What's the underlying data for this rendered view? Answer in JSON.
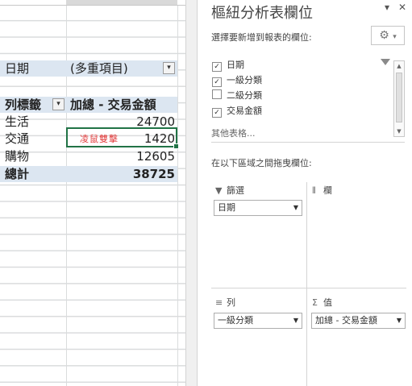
{
  "pivot": {
    "filter_label": "日期",
    "filter_value": "(多重項目)",
    "row_header": "列標籤",
    "value_header": "加總 - 交易金額",
    "rows": [
      {
        "label": "生活",
        "value": "24700"
      },
      {
        "label": "交通",
        "value": "1420"
      },
      {
        "label": "購物",
        "value": "12605"
      }
    ],
    "total_label": "總計",
    "total_value": "38725",
    "watermark": "凌鼠雙擊"
  },
  "pane": {
    "title": "樞紐分析表欄位",
    "close_label": "✕",
    "menu_label": "▾",
    "instruction": "選擇要新增到報表的欄位:",
    "gear_icon": "gear-icon",
    "fields": [
      {
        "label": "日期",
        "checked": true
      },
      {
        "label": "一級分類",
        "checked": true
      },
      {
        "label": "二級分類",
        "checked": false
      },
      {
        "label": "交易金額",
        "checked": true
      }
    ],
    "more_tables": "其他表格...",
    "drag_hint": "在以下區域之間拖曳欄位:",
    "areas": {
      "filters": {
        "title": "篩選",
        "item": "日期"
      },
      "columns": {
        "title": "欄"
      },
      "rows": {
        "title": "列",
        "item": "一級分類"
      },
      "values": {
        "title": "值",
        "item": "加總 - 交易金額"
      }
    }
  }
}
